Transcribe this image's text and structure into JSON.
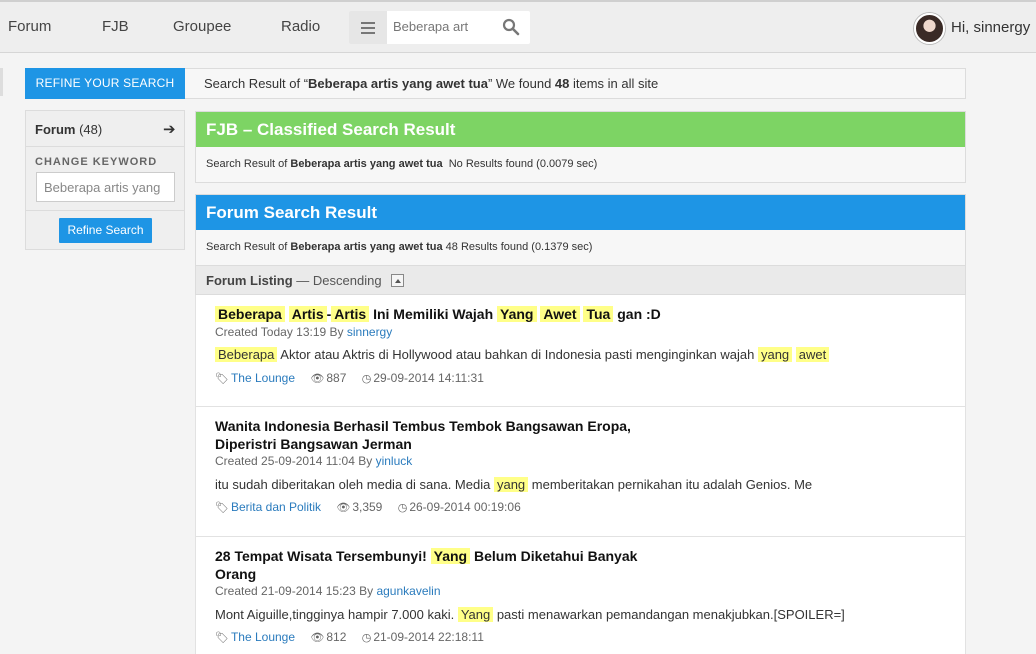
{
  "nav": {
    "items": [
      "Forum",
      "FJB",
      "Groupee",
      "Radio"
    ],
    "search_value": "Beberapa art",
    "greeting": "Hi, sinnergy"
  },
  "sidebar": {
    "tab_label": "REFINE YOUR SEARCH",
    "forum_label": "Forum",
    "forum_count": "(48)",
    "change_keyword_label": "CHANGE KEYWORD",
    "keyword_value": "Beberapa artis yang",
    "refine_button": "Refine Search"
  },
  "summary": {
    "prefix": "Search Result of “",
    "query": "Beberapa artis yang awet tua",
    "middle": "” We found ",
    "count": "48",
    "suffix": " items in all site"
  },
  "fjb": {
    "title": "FJB – Classified Search Result",
    "prefix": "Search Result of ",
    "query": "Beberapa artis yang awet tua",
    "result": "  No Results found (0.0079 sec)",
    "color": "#7dd464"
  },
  "forum_result": {
    "title": "Forum Search Result",
    "prefix": "Search Result of ",
    "query": "Beberapa artis yang awet tua",
    "result": " 48 Results found (0.1379 sec)",
    "color": "#1e95e5"
  },
  "listing": {
    "label": "Forum Listing",
    "order": " — Descending"
  },
  "posts": [
    {
      "title_parts": [
        {
          "t": "Beberapa",
          "h": true
        },
        {
          "t": " ",
          "h": false
        },
        {
          "t": "Artis",
          "h": true
        },
        {
          "t": "-",
          "h": false
        },
        {
          "t": "Artis",
          "h": true
        },
        {
          "t": " Ini Memiliki Wajah ",
          "h": false
        },
        {
          "t": "Yang",
          "h": true
        },
        {
          "t": " ",
          "h": false
        },
        {
          "t": "Awet",
          "h": true
        },
        {
          "t": " ",
          "h": false
        },
        {
          "t": "Tua",
          "h": true
        },
        {
          "t": " gan :D",
          "h": false
        }
      ],
      "created": "Created Today 13:19 By ",
      "author": "sinnergy",
      "snippet_parts": [
        {
          "t": "Beberapa",
          "h": true
        },
        {
          "t": " Aktor atau Aktris di Hollywood atau bahkan di Indonesia pasti menginginkan wajah ",
          "h": false
        },
        {
          "t": "yang",
          "h": true
        },
        {
          "t": " ",
          "h": false
        },
        {
          "t": "awet",
          "h": true
        }
      ],
      "category": "The Lounge",
      "views": "887",
      "date": "29-09-2014 14:11:31"
    },
    {
      "title_parts": [
        {
          "t": "Wanita Indonesia Berhasil Tembus Tembok Bangsawan Eropa, Diperistri Bangsawan Jerman",
          "h": false
        }
      ],
      "created": "Created 25-09-2014 11:04 By ",
      "author": "yinluck",
      "snippet_parts": [
        {
          "t": "itu sudah diberitakan oleh media di sana. Media ",
          "h": false
        },
        {
          "t": "yang",
          "h": true
        },
        {
          "t": " memberitakan pernikahan itu adalah Genios. Me",
          "h": false
        }
      ],
      "category": "Berita dan Politik",
      "views": "3,359",
      "date": "26-09-2014 00:19:06"
    },
    {
      "title_parts": [
        {
          "t": "28 Tempat Wisata Tersembunyi! ",
          "h": false
        },
        {
          "t": "Yang",
          "h": true
        },
        {
          "t": " Belum Diketahui Banyak Orang",
          "h": false
        }
      ],
      "created": "Created 21-09-2014 15:23 By ",
      "author": "agunkavelin",
      "snippet_parts": [
        {
          "t": "Mont Aiguille,tingginya hampir 7.000 kaki. ",
          "h": false
        },
        {
          "t": "Yang",
          "h": true
        },
        {
          "t": " pasti menawarkan pemandangan menakjubkan.[SPOILER=]",
          "h": false
        }
      ],
      "category": "The Lounge",
      "views": "812",
      "date": "21-09-2014 22:18:11"
    }
  ]
}
